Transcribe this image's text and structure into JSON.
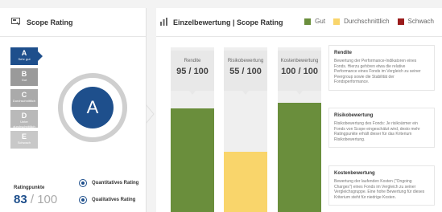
{
  "left": {
    "title": "Scope Rating",
    "ladder": [
      {
        "grade": "A",
        "sub": "Sehr gut",
        "active": true
      },
      {
        "grade": "B",
        "sub": "Gut",
        "active": false
      },
      {
        "grade": "C",
        "sub": "Durchschnittlich",
        "active": false
      },
      {
        "grade": "D",
        "sub": "Unter durchschnittlich",
        "active": false
      },
      {
        "grade": "E",
        "sub": "Schwach",
        "active": false
      }
    ],
    "big_grade": "A",
    "ratingpunkte_label": "Ratingpunkte",
    "ratingpunkte_value": "83",
    "ratingpunkte_max": " / 100",
    "radio_quant": "Quantitatives Rating",
    "radio_qual": "Qualitatives Rating"
  },
  "right": {
    "title": "Einzelbewertung | Scope Rating",
    "legend": [
      {
        "label": "Gut",
        "color": "#6a8e3c"
      },
      {
        "label": "Durchschnittlich",
        "color": "#f9d56b"
      },
      {
        "label": "Schwach",
        "color": "#9b1c1c"
      }
    ],
    "columns": [
      {
        "label": "Rendite",
        "score": "95 / 100",
        "value": 95,
        "color": "#6a8e3c"
      },
      {
        "label": "Risikobewertung",
        "score": "55 / 100",
        "value": 55,
        "color": "#f9d56b"
      },
      {
        "label": "Kostenbewertung",
        "score": "100 / 100",
        "value": 100,
        "color": "#6a8e3c"
      }
    ],
    "descriptions": [
      {
        "heading": "Rendite",
        "text": "Bewertung der Performance-Indikatoren eines Fonds. Hierzu gehören etwa die relative Performance eines Fonds im Vergleich zu seiner Peergroup sowie die Stabilität der Fondsperformance."
      },
      {
        "heading": "Risikobewertung",
        "text": "Risikobewertung des Fonds: Je risikoärmer ein Fonds von Scope eingeschätzt wird, desto mehr Ratingpunkte erhält dieser für das Kriterium Risikobewertung."
      },
      {
        "heading": "Kostenbewertung",
        "text": "Bewertung der laufenden Kosten (\"Ongoing Charges\") eines Fonds im Vergleich zu seiner Vergleichsgruppe. Eine hohe Bewertung für dieses Kriterium steht für niedrige Kosten."
      }
    ]
  }
}
